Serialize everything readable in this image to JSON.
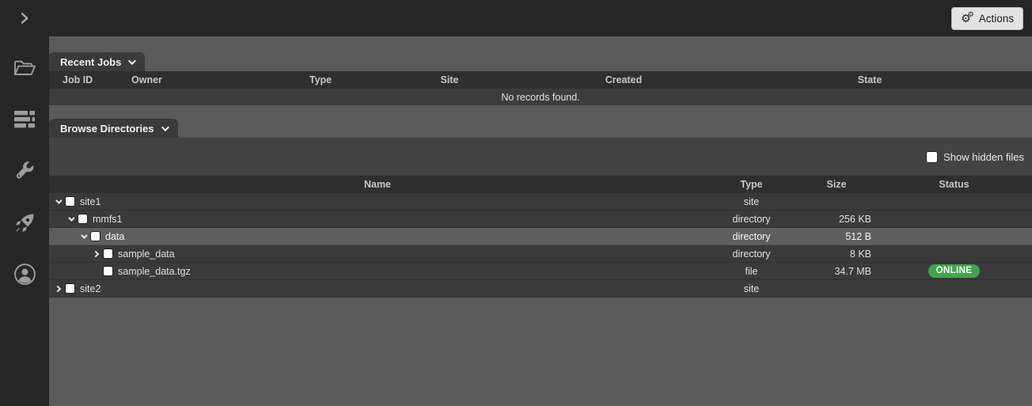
{
  "colors": {
    "topbar_bg": "#262626",
    "main_bg": "#5a5a5a",
    "panel_strip_bg": "#434343",
    "table_header_bg": "#2f2f2f",
    "row_bg": "#3a3a3a",
    "row_highlight_bg": "#5e5e5e",
    "tab_bg": "#3a3a3a",
    "online_badge": "#3fa64d"
  },
  "topbar": {
    "sidebar_toggle_icon": "chevron-right",
    "actions": {
      "label": "Actions",
      "icon": "cogs",
      "glyph": "⚙"
    }
  },
  "sidebar": {
    "items": [
      {
        "icon": "folder-open"
      },
      {
        "icon": "job-queue"
      },
      {
        "icon": "wrench"
      },
      {
        "icon": "rocket"
      },
      {
        "icon": "user-circle"
      }
    ]
  },
  "recent_jobs": {
    "title": "Recent Jobs",
    "columns": [
      "Job ID",
      "Owner",
      "Type",
      "Site",
      "Created",
      "State"
    ],
    "empty_message": "No records found."
  },
  "browse_directories": {
    "title": "Browse Directories",
    "show_hidden": {
      "label": "Show hidden files",
      "checked": false
    },
    "columns": [
      "Name",
      "Type",
      "Size",
      "Status"
    ],
    "rows": [
      {
        "name": "site1",
        "level": 0,
        "expander": "expanded",
        "checked": false,
        "type": "site",
        "size": "",
        "status": "",
        "highlighted": false
      },
      {
        "name": "mmfs1",
        "level": 1,
        "expander": "expanded",
        "checked": false,
        "type": "directory",
        "size": "256 KB",
        "status": "",
        "highlighted": false
      },
      {
        "name": "data",
        "level": 2,
        "expander": "expanded",
        "checked": false,
        "type": "directory",
        "size": "512 B",
        "status": "",
        "highlighted": true
      },
      {
        "name": "sample_data",
        "level": 3,
        "expander": "collapsed",
        "checked": false,
        "type": "directory",
        "size": "8 KB",
        "status": "",
        "highlighted": false
      },
      {
        "name": "sample_data.tgz",
        "level": 3,
        "expander": "none",
        "checked": false,
        "type": "file",
        "size": "34.7 MB",
        "status": "ONLINE",
        "highlighted": false
      },
      {
        "name": "site2",
        "level": 0,
        "expander": "collapsed",
        "checked": false,
        "type": "site",
        "size": "",
        "status": "",
        "highlighted": false
      }
    ]
  }
}
